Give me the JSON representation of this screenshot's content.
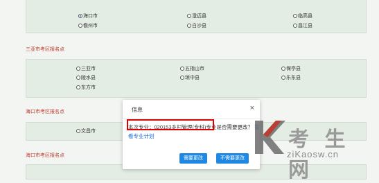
{
  "top_group": {
    "row1": [
      "海口市",
      "澄迈县",
      "临高县"
    ],
    "row2": [
      "儋州市",
      "白沙县",
      "昌江县"
    ],
    "selected": "海口市"
  },
  "sanya_section": {
    "title": "三亚市考区报名点",
    "row1": [
      "三亚市",
      "五指山市",
      "保亭县"
    ],
    "row2": [
      "陵水县",
      "琼中县",
      "乐东县"
    ],
    "row3": [
      "东方市"
    ]
  },
  "haikou_section_1": {
    "title": "海口市考区报名点",
    "row1": [
      "文昌市"
    ]
  },
  "haikou_section_2": {
    "title": "海口市考区报名点"
  },
  "dialog": {
    "title": "信息",
    "close": "×",
    "message_part1": "本次专业：020153乡村管理(专科)",
    "message_part2": "专业是否需要更改？",
    "link": "查看专业计划",
    "confirm_button": "需要更改",
    "cancel_button": "不需要更改"
  },
  "watermark": {
    "text": "考 生 网",
    "url": "ziKaosw.cn"
  }
}
